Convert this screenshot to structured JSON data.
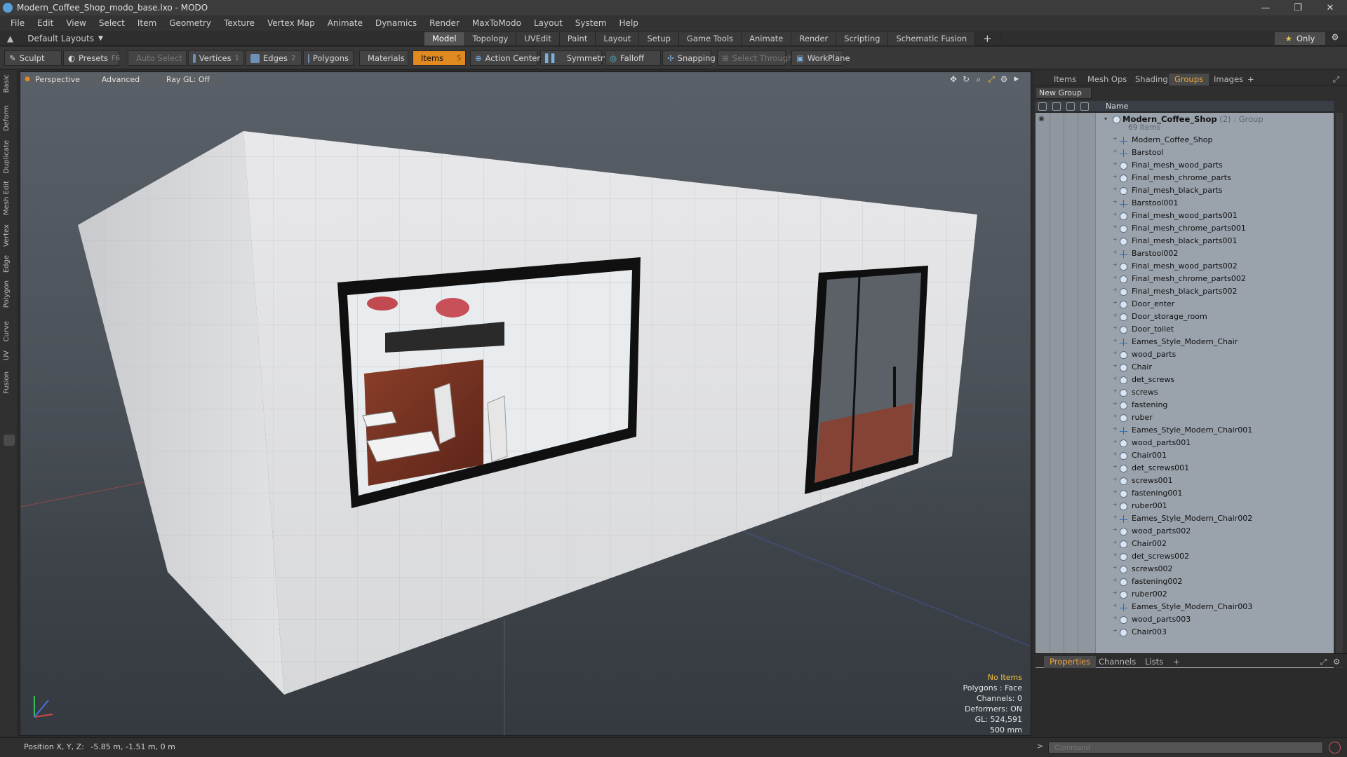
{
  "window": {
    "title": "Modern_Coffee_Shop_modo_base.lxo - MODO",
    "controls": [
      "—",
      "❐",
      "✕"
    ]
  },
  "menu": [
    "File",
    "Edit",
    "View",
    "Select",
    "Item",
    "Geometry",
    "Texture",
    "Vertex Map",
    "Animate",
    "Dynamics",
    "Render",
    "MaxToModo",
    "Layout",
    "System",
    "Help"
  ],
  "layout": {
    "current": "Default Layouts",
    "tabs": [
      "Model",
      "Topology",
      "UVEdit",
      "Paint",
      "Layout",
      "Setup",
      "Game Tools",
      "Animate",
      "Render",
      "Scripting",
      "Schematic Fusion"
    ],
    "active_tab": "Model",
    "add_tab": "+",
    "only_label": "Only"
  },
  "toolbar": {
    "sculpt": "Sculpt",
    "presets": "Presets",
    "presets_key": "F6",
    "auto_select": "Auto Select",
    "vertices": "Vertices",
    "vertices_key": "1",
    "edges": "Edges",
    "edges_key": "2",
    "polygons": "Polygons",
    "materials": "Materials",
    "items": "Items",
    "items_key": "5",
    "action_center": "Action Center",
    "symmetry": "Symmetry",
    "falloff": "Falloff",
    "snapping": "Snapping",
    "select_through": "Select Through",
    "workplane": "WorkPlane"
  },
  "left_tabs": [
    "Basic",
    "Deform",
    "Duplicate",
    "Mesh Edit",
    "Vertex",
    "Edge",
    "Polygon",
    "Curve",
    "UV",
    "Fusion"
  ],
  "viewport": {
    "view": "Perspective",
    "shading": "Advanced",
    "raygl": "Ray GL: Off",
    "info": {
      "selection": "No Items",
      "polygons": "Polygons : Face",
      "channels": "Channels: 0",
      "deformers": "Deformers: ON",
      "gl": "GL: 524,591",
      "scale": "500 mm"
    }
  },
  "right_panel": {
    "tabs": [
      "Items",
      "Mesh Ops",
      "Shading",
      "Groups",
      "Images",
      "+"
    ],
    "active_tab": "Groups",
    "new_group": "New Group",
    "column_name": "Name",
    "group": {
      "name": "Modern_Coffee_Shop",
      "suffix": " (2) : Group",
      "count": "69 Items"
    },
    "items": [
      {
        "name": "Modern_Coffee_Shop",
        "type": "locator"
      },
      {
        "name": "Barstool",
        "type": "locator"
      },
      {
        "name": "Final_mesh_wood_parts",
        "type": "mesh"
      },
      {
        "name": "Final_mesh_chrome_parts",
        "type": "mesh"
      },
      {
        "name": "Final_mesh_black_parts",
        "type": "mesh"
      },
      {
        "name": "Barstool001",
        "type": "locator"
      },
      {
        "name": "Final_mesh_wood_parts001",
        "type": "mesh"
      },
      {
        "name": "Final_mesh_chrome_parts001",
        "type": "mesh"
      },
      {
        "name": "Final_mesh_black_parts001",
        "type": "mesh"
      },
      {
        "name": "Barstool002",
        "type": "locator"
      },
      {
        "name": "Final_mesh_wood_parts002",
        "type": "mesh"
      },
      {
        "name": "Final_mesh_chrome_parts002",
        "type": "mesh"
      },
      {
        "name": "Final_mesh_black_parts002",
        "type": "mesh"
      },
      {
        "name": "Door_enter",
        "type": "mesh"
      },
      {
        "name": "Door_storage_room",
        "type": "mesh"
      },
      {
        "name": "Door_toilet",
        "type": "mesh"
      },
      {
        "name": "Eames_Style_Modern_Chair",
        "type": "locator"
      },
      {
        "name": "wood_parts",
        "type": "mesh"
      },
      {
        "name": "Chair",
        "type": "mesh"
      },
      {
        "name": "det_screws",
        "type": "mesh"
      },
      {
        "name": "screws",
        "type": "mesh"
      },
      {
        "name": "fastening",
        "type": "mesh"
      },
      {
        "name": "ruber",
        "type": "mesh"
      },
      {
        "name": "Eames_Style_Modern_Chair001",
        "type": "locator"
      },
      {
        "name": "wood_parts001",
        "type": "mesh"
      },
      {
        "name": "Chair001",
        "type": "mesh"
      },
      {
        "name": "det_screws001",
        "type": "mesh"
      },
      {
        "name": "screws001",
        "type": "mesh"
      },
      {
        "name": "fastening001",
        "type": "mesh"
      },
      {
        "name": "ruber001",
        "type": "mesh"
      },
      {
        "name": "Eames_Style_Modern_Chair002",
        "type": "locator"
      },
      {
        "name": "wood_parts002",
        "type": "mesh"
      },
      {
        "name": "Chair002",
        "type": "mesh"
      },
      {
        "name": "det_screws002",
        "type": "mesh"
      },
      {
        "name": "screws002",
        "type": "mesh"
      },
      {
        "name": "fastening002",
        "type": "mesh"
      },
      {
        "name": "ruber002",
        "type": "mesh"
      },
      {
        "name": "Eames_Style_Modern_Chair003",
        "type": "locator"
      },
      {
        "name": "wood_parts003",
        "type": "mesh"
      },
      {
        "name": "Chair003",
        "type": "mesh"
      }
    ],
    "prop_tabs": [
      "Properties",
      "Channels",
      "Lists",
      "+"
    ],
    "active_prop_tab": "Properties"
  },
  "status": {
    "position_label": "Position X, Y, Z:",
    "position_value": "-5.85 m, -1.51 m, 0 m",
    "command_placeholder": "Command"
  },
  "colors": {
    "accent": "#e08a20",
    "active_tab_text": "#f0a43a",
    "grid_bg": "#9aa2ab"
  }
}
